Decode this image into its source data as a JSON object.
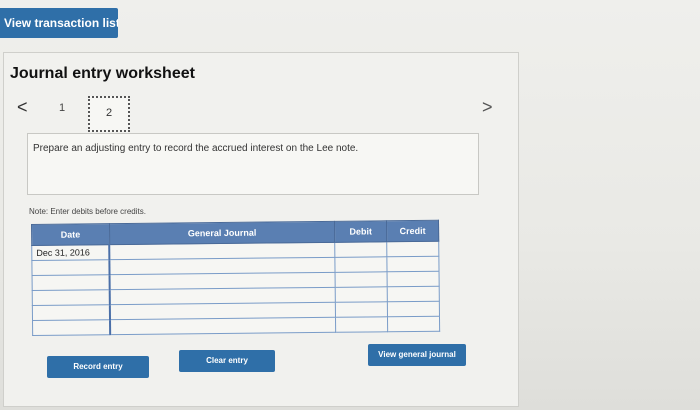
{
  "header": {
    "view_transaction_label": "View transaction list"
  },
  "worksheet": {
    "title": "Journal entry worksheet",
    "steps": [
      "1",
      "2"
    ],
    "active_step": "2",
    "prev_glyph": "<",
    "next_glyph": ">",
    "prompt": "Prepare an adjusting entry to record the accrued interest on the Lee note.",
    "note": "Note: Enter debits before credits."
  },
  "table": {
    "headers": [
      "Date",
      "General Journal",
      "Debit",
      "Credit"
    ],
    "rows": [
      [
        "Dec 31, 2016",
        "",
        "",
        ""
      ],
      [
        "",
        "",
        "",
        ""
      ],
      [
        "",
        "",
        "",
        ""
      ],
      [
        "",
        "",
        "",
        ""
      ],
      [
        "",
        "",
        "",
        ""
      ],
      [
        "",
        "",
        "",
        ""
      ]
    ]
  },
  "buttons": {
    "record": "Record entry",
    "clear": "Clear entry",
    "view_journal": "View general journal"
  },
  "colors": {
    "accent": "#2f6fa8",
    "table_header": "#5a7fb2"
  }
}
